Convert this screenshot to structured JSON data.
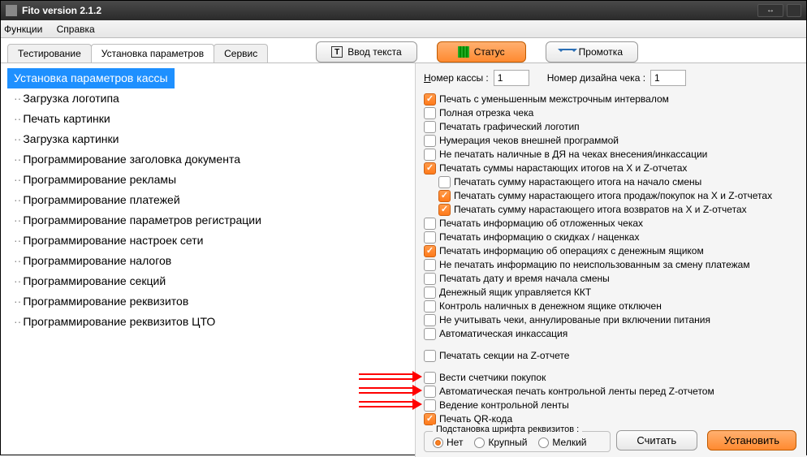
{
  "title": "Fito version 2.1.2",
  "menu": {
    "functions": "Функции",
    "help": "Справка"
  },
  "tabs": {
    "testing": "Тестирование",
    "params": "Установка параметров",
    "service": "Сервис"
  },
  "toolbar": {
    "text_input": "Ввод текста",
    "status": "Статус",
    "feed": "Промотка"
  },
  "tree": {
    "items": [
      "Установка параметров кассы",
      "Загрузка логотипа",
      "Печать картинки",
      "Загрузка картинки",
      "Программирование заголовка документа",
      "Программирование рекламы",
      "Программирование платежей",
      "Программирование параметров регистрации",
      "Программирование настроек сети",
      "Программирование налогов",
      "Программирование секций",
      "Программирование реквизитов",
      "Программирование реквизитов ЦТО"
    ],
    "selected_index": 0
  },
  "inputs": {
    "kassa_label": "Номер кассы :",
    "kassa_value": "1",
    "design_label": "Номер дизайна чека :",
    "design_value": "1"
  },
  "checks": [
    {
      "label": "Печать с уменьшенным межстрочным интервалом",
      "checked": true,
      "indent": false
    },
    {
      "label": "Полная отрезка чека",
      "checked": false,
      "indent": false
    },
    {
      "label": "Печатать графический логотип",
      "checked": false,
      "indent": false
    },
    {
      "label": "Нумерация чеков внешней программой",
      "checked": false,
      "indent": false
    },
    {
      "label": "Не печатать наличные в ДЯ на чеках внесения/инкассации",
      "checked": false,
      "indent": false
    },
    {
      "label": "Печатать суммы нарастающих итогов на X и Z-отчетах",
      "checked": true,
      "indent": false
    },
    {
      "label": "Печатать сумму нарастающего итога на начало смены",
      "checked": false,
      "indent": true
    },
    {
      "label": "Печатать сумму нарастающего итога продаж/покупок на X и Z-отчетах",
      "checked": true,
      "indent": true
    },
    {
      "label": "Печатать сумму нарастающего итога возвратов на X и Z-отчетах",
      "checked": true,
      "indent": true
    },
    {
      "label": "Печатать информацию об отложенных чеках",
      "checked": false,
      "indent": false
    },
    {
      "label": "Печатать информацию о скидках / наценках",
      "checked": false,
      "indent": false
    },
    {
      "label": "Печатать информацию об операциях с денежным ящиком",
      "checked": true,
      "indent": false
    },
    {
      "label": "Не печатать информацию по неиспользованным за смену платежам",
      "checked": false,
      "indent": false
    },
    {
      "label": "Печатать дату и время начала смены",
      "checked": false,
      "indent": false
    },
    {
      "label": "Денежный ящик управляется ККТ",
      "checked": false,
      "indent": false
    },
    {
      "label": "Контроль наличных в денежном ящике отключен",
      "checked": false,
      "indent": false
    },
    {
      "label": "Не учитывать чеки, аннулированые при включении питания",
      "checked": false,
      "indent": false
    },
    {
      "label": "Автоматическая инкассация",
      "checked": false,
      "indent": false
    }
  ],
  "gap1_label": "Печатать секции на Z-отчете",
  "bottom_checks": [
    {
      "label": "Вести счетчики покупок",
      "checked": false,
      "arrow": true
    },
    {
      "label": "Автоматическая печать контрольной ленты перед Z-отчетом",
      "checked": false,
      "arrow": true
    },
    {
      "label": "Ведение контрольной ленты",
      "checked": false,
      "arrow": true
    },
    {
      "label": "Печать QR-кода",
      "checked": true
    }
  ],
  "radio_group": {
    "legend": "Подстановка шрифта реквизитов :",
    "options": [
      {
        "label": "Нет",
        "checked": true
      },
      {
        "label": "Крупный",
        "checked": false
      },
      {
        "label": "Мелкий",
        "checked": false
      }
    ]
  },
  "buttons": {
    "read": "Считать",
    "set": "Установить"
  }
}
